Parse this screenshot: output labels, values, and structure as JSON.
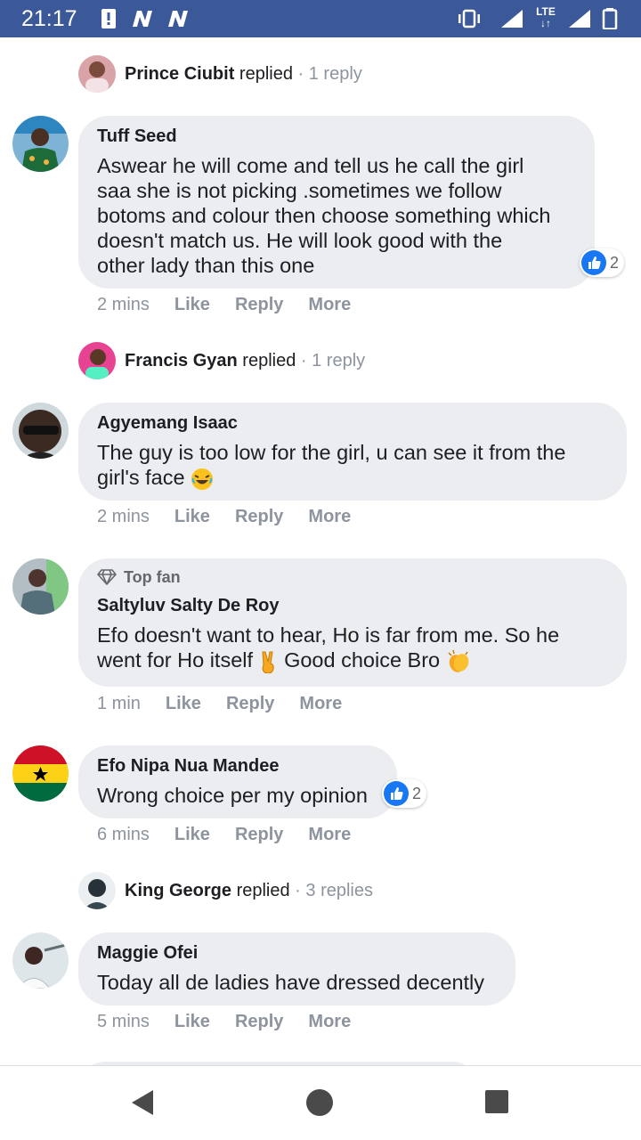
{
  "status_bar": {
    "time": "21:17",
    "icons": [
      "alert-icon",
      "n-icon",
      "n-icon",
      "vibrate-icon",
      "signal-icon",
      "lte-icon",
      "signal-icon",
      "battery-icon"
    ],
    "lte_label": "LTE"
  },
  "comments": [
    {
      "type": "reply-summary",
      "name": "Prince Ciubit",
      "verb": "replied",
      "sep": " · ",
      "count": "1 reply"
    },
    {
      "type": "comment",
      "author": "Tuff Seed",
      "lines": [
        "Aswear he will come and tell us he call the girl",
        "saa she is not picking .sometimes we follow",
        "botoms and colour then choose something which",
        "doesn't match us. He will look good with the",
        "other lady than this one"
      ],
      "reactions": "2",
      "time": "2 mins",
      "like": "Like",
      "reply": "Reply",
      "more": "More"
    },
    {
      "type": "reply-summary",
      "name": "Francis Gyan",
      "verb": "replied",
      "sep": " · ",
      "count": "1 reply"
    },
    {
      "type": "comment",
      "author": "Agyemang Isaac",
      "lines": [
        "The guy is too low for the girl, u can see it from the",
        "girl's face"
      ],
      "time": "2 mins",
      "like": "Like",
      "reply": "Reply",
      "more": "More"
    },
    {
      "type": "comment",
      "badge": "Top fan",
      "author": "Saltyluv Salty De Roy",
      "lines": [
        "Efo doesn't want to hear, Ho is far from me. So he",
        "went for Ho itself",
        "Good choice Bro"
      ],
      "time": "1 min",
      "like": "Like",
      "reply": "Reply",
      "more": "More"
    },
    {
      "type": "comment",
      "author": "Efo Nipa Nua Mandee",
      "lines": [
        "Wrong choice per my opinion"
      ],
      "reactions": "2",
      "time": "6 mins",
      "like": "Like",
      "reply": "Reply",
      "more": "More"
    },
    {
      "type": "reply-summary",
      "name": "King George",
      "verb": "replied",
      "sep": " · ",
      "count": "3 replies"
    },
    {
      "type": "comment",
      "author": "Maggie Ofei",
      "lines": [
        "Today all de ladies have dressed decently"
      ],
      "time": "5 mins",
      "like": "Like",
      "reply": "Reply",
      "more": "More"
    }
  ],
  "colors": {
    "status_bar": "#3b5998",
    "bubble": "#ebedf0",
    "muted_text": "#8d949e",
    "like_blue": "#1877f2"
  },
  "nav": [
    "back-icon",
    "home-icon",
    "recents-icon"
  ]
}
